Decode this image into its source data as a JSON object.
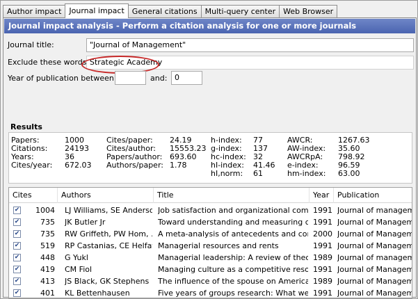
{
  "tabs": [
    "Author impact",
    "Journal impact",
    "General citations",
    "Multi-query center",
    "Web Browser"
  ],
  "banner": "Journal impact analysis - Perform a citation analysis for one or more journals",
  "form": {
    "journal_title_label": "Journal title:",
    "journal_title_value": "\"Journal of Management\"",
    "exclude_label": "Exclude these words:",
    "exclude_value": "Strategic Academy",
    "year_label": "Year of publication between:",
    "year_from": "",
    "and_label": "and:",
    "year_to": "0"
  },
  "results": {
    "title": "Results",
    "col1": [
      [
        "Papers:",
        "1000"
      ],
      [
        "Citations:",
        "24193"
      ],
      [
        "Years:",
        "36"
      ],
      [
        "Cites/year:",
        "672.03"
      ]
    ],
    "col2": [
      [
        "Cites/paper:",
        "24.19"
      ],
      [
        "Cites/author:",
        "15553.23"
      ],
      [
        "Papers/author:",
        "693.60"
      ],
      [
        "Authors/paper:",
        "1.78"
      ]
    ],
    "col3": [
      [
        "h-index:",
        "77"
      ],
      [
        "g-index:",
        "137"
      ],
      [
        "hc-index:",
        "32"
      ],
      [
        "hI-index:",
        "41.46"
      ],
      [
        "hI,norm:",
        "61"
      ]
    ],
    "col4": [
      [
        "AWCR:",
        "1267.63"
      ],
      [
        "AW-index:",
        "35.60"
      ],
      [
        "AWCRpA:",
        "798.92"
      ],
      [
        "e-index:",
        "96.59"
      ],
      [
        "hm-index:",
        "63.00"
      ]
    ]
  },
  "table": {
    "headers": [
      "Cites",
      "Authors",
      "Title",
      "Year",
      "Publication"
    ],
    "rows": [
      {
        "checked": "✔",
        "cites": "1004",
        "authors": "LJ Williams, SE Anderson",
        "title": "Job satisfaction and organizational comm...",
        "year": "1991",
        "pub": "Journal of management"
      },
      {
        "checked": "✔",
        "cites": "735",
        "authors": "JK Butler Jr",
        "title": "Toward understanding and measuring co...",
        "year": "1991",
        "pub": "Journal of Management"
      },
      {
        "checked": "✔",
        "cites": "735",
        "authors": "RW Griffeth, PW Hom, ...",
        "title": "A meta-analysis of antecedents and corr...",
        "year": "2000",
        "pub": "Journal of Management"
      },
      {
        "checked": "✔",
        "cites": "519",
        "authors": "RP Castanias, CE Helfat",
        "title": "Managerial resources and rents",
        "year": "1991",
        "pub": "Journal of Management"
      },
      {
        "checked": "✔",
        "cites": "448",
        "authors": "G Yukl",
        "title": "Managerial leadership: A review of theor...",
        "year": "1989",
        "pub": "Journal of management"
      },
      {
        "checked": "✔",
        "cites": "419",
        "authors": "CM Fiol",
        "title": "Managing culture as a competitive resou...",
        "year": "1991",
        "pub": "Journal of Management"
      },
      {
        "checked": "✔",
        "cites": "413",
        "authors": "JS Black, GK Stephens",
        "title": "The influence of the spouse on American...",
        "year": "1989",
        "pub": "Journal of Management"
      },
      {
        "checked": "✔",
        "cites": "401",
        "authors": "KL Bettenhausen",
        "title": "Five years of groups research: What we...",
        "year": "1991",
        "pub": "Journal of Management"
      }
    ]
  }
}
